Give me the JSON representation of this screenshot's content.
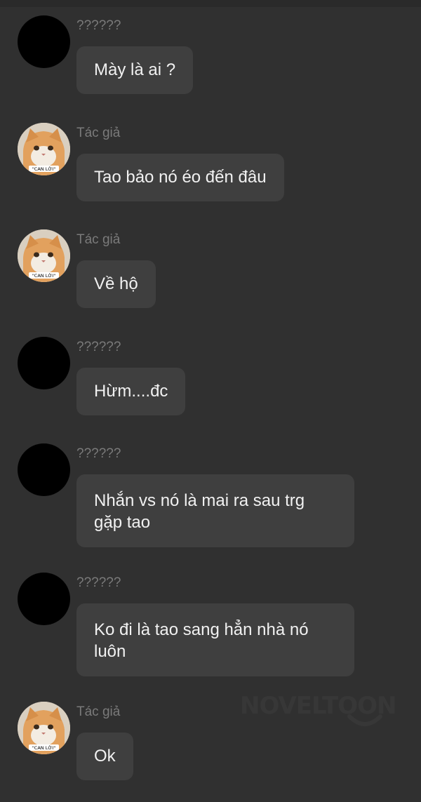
{
  "messages": [
    {
      "sender": "??????",
      "avatar": "black-avatar",
      "text": "Mày là ai ?"
    },
    {
      "sender": "Tác giả",
      "avatar": "cat-avatar",
      "avatar_caption": "\"CAN LỜI\"",
      "text": "Tao bảo nó éo đến đâu"
    },
    {
      "sender": "Tác giả",
      "avatar": "cat-avatar",
      "avatar_caption": "\"CAN LỜI\"",
      "text": "Về hộ"
    },
    {
      "sender": "??????",
      "avatar": "black-avatar",
      "text": "Hừm....đc"
    },
    {
      "sender": "??????",
      "avatar": "black-avatar",
      "text": "Nhắn vs nó là mai ra sau trg gặp tao"
    },
    {
      "sender": "??????",
      "avatar": "black-avatar",
      "text": "Ko đi là tao sang hẳn nhà nó luôn"
    },
    {
      "sender": "Tác giả",
      "avatar": "cat-avatar",
      "avatar_caption": "\"CAN LỜI\"",
      "text": "Ok"
    }
  ],
  "watermark": {
    "text": "NOVELTOON"
  },
  "colors": {
    "background": "#303030",
    "bubble": "#3f3f3f",
    "bubble_text": "#f1f1f1",
    "sender_text": "#7a7a7a"
  }
}
